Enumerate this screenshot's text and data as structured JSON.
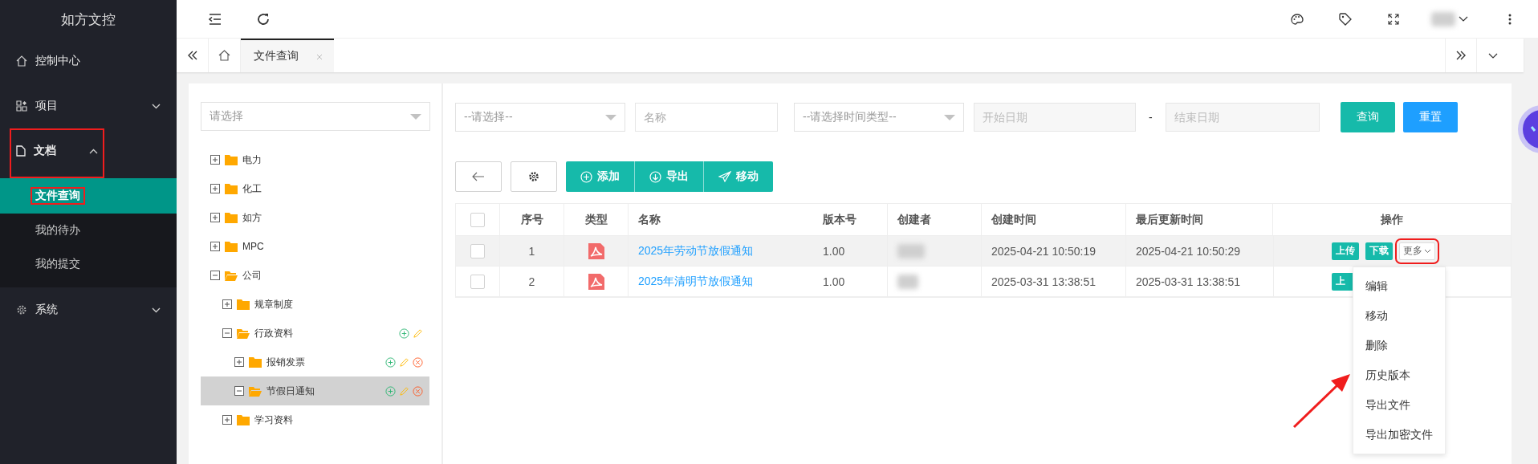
{
  "sidebar": {
    "title": "如方文控",
    "menu": [
      {
        "label": "控制中心",
        "highlighted": false
      },
      {
        "label": "项目",
        "expanded": false,
        "highlighted": false
      },
      {
        "label": "文档",
        "expanded": true,
        "highlighted": true,
        "children": [
          {
            "label": "文件查询",
            "selected": true,
            "highlighted": true
          },
          {
            "label": "我的待办",
            "selected": false,
            "highlighted": false
          },
          {
            "label": "我的提交",
            "selected": false,
            "highlighted": false
          }
        ]
      },
      {
        "label": "系统",
        "expanded": false,
        "highlighted": false
      }
    ]
  },
  "tabs": [
    {
      "label": "文件查询",
      "selected": true
    }
  ],
  "tree": {
    "placeholder": "请选择",
    "nodes": [
      {
        "label": "电力",
        "expanded": false,
        "selected": false
      },
      {
        "label": "化工",
        "expanded": false,
        "selected": false
      },
      {
        "label": "如方",
        "expanded": false,
        "selected": false
      },
      {
        "label": "MPC",
        "expanded": false,
        "selected": false
      },
      {
        "label": "公司",
        "expanded": true,
        "selected": false,
        "children": [
          {
            "label": "规章制度",
            "expanded": false,
            "selected": false
          },
          {
            "label": "行政资料",
            "expanded": true,
            "selected": false,
            "actions": [
              {
                "kind": "add"
              },
              {
                "kind": "edit"
              }
            ],
            "children": [
              {
                "label": "报销发票",
                "expanded": false,
                "selected": false,
                "actions": [
                  {
                    "kind": "add"
                  },
                  {
                    "kind": "edit"
                  },
                  {
                    "kind": "delete"
                  }
                ]
              },
              {
                "label": "节假日通知",
                "expanded": true,
                "selected": true,
                "actions": [
                  {
                    "kind": "add"
                  },
                  {
                    "kind": "edit"
                  },
                  {
                    "kind": "delete"
                  }
                ]
              }
            ]
          },
          {
            "label": "学习资料",
            "expanded": false,
            "selected": false
          }
        ]
      }
    ]
  },
  "filters": [
    {
      "kind": "select",
      "placeholder": "--请选择--"
    },
    {
      "kind": "input",
      "placeholder": "名称"
    },
    {
      "kind": "select",
      "placeholder": "--请选择时间类型--"
    },
    {
      "kind": "date",
      "placeholder": "开始日期"
    },
    {
      "kind": "separator",
      "text": "-"
    },
    {
      "kind": "date",
      "placeholder": "结束日期"
    }
  ],
  "filter_buttons": [
    {
      "label": "查询",
      "kind": "primary"
    },
    {
      "label": "重置",
      "kind": "info"
    }
  ],
  "toolbar": {
    "buttons": [
      {
        "label": "添加"
      },
      {
        "label": "导出"
      },
      {
        "label": "移动"
      }
    ]
  },
  "table": {
    "all_selected": false,
    "columns": [
      "序号",
      "类型",
      "名称",
      "版本号",
      "创建者",
      "创建时间",
      "最后更新时间",
      "操作"
    ],
    "rows": [
      {
        "selected": false,
        "highlighted": true,
        "index": "1",
        "name": "2025年劳动节放假通知",
        "version": "1.00",
        "created": "2025-04-21 10:50:19",
        "updated": "2025-04-21 10:50:29",
        "actions": [
          "上传",
          "下载"
        ],
        "more": "更多"
      },
      {
        "selected": false,
        "highlighted": false,
        "index": "2",
        "name": "2025年清明节放假通知",
        "version": "1.00",
        "created": "2025-03-31 13:38:51",
        "updated": "2025-03-31 13:38:51",
        "actions": [
          "上"
        ]
      }
    ]
  },
  "dropdown": {
    "items": [
      "编辑",
      "移动",
      "删除",
      "历史版本",
      "导出文件",
      "导出加密文件"
    ]
  }
}
